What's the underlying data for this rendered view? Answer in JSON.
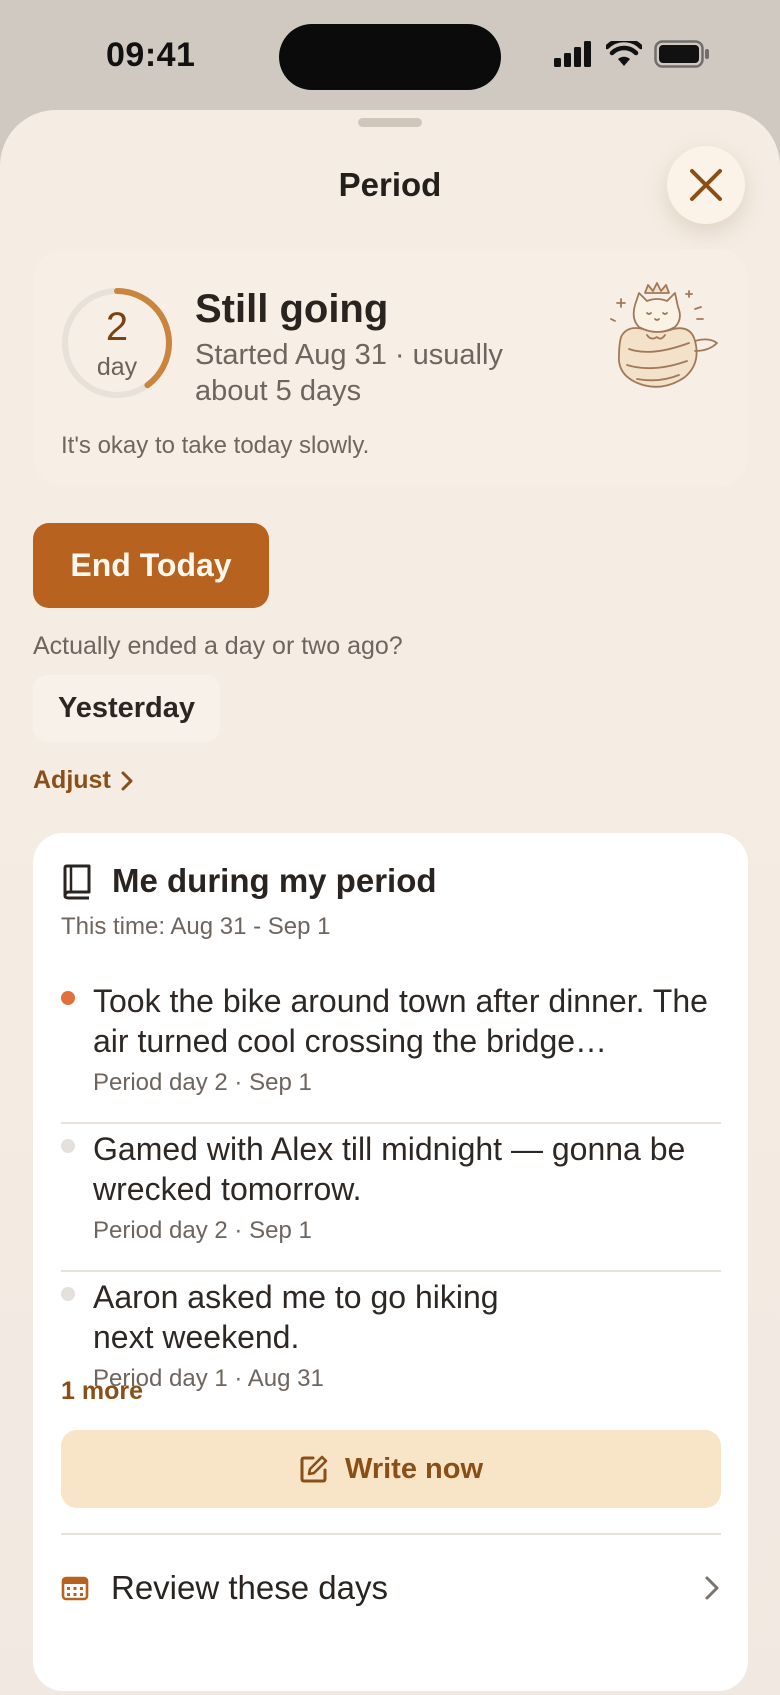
{
  "status_bar": {
    "time": "09:41"
  },
  "sheet": {
    "title": "Period"
  },
  "status_card": {
    "day_number": "2",
    "day_unit": "day",
    "progress_fraction": 0.4,
    "heading": "Still going",
    "subtitle": "Started Aug 31 · usually about 5 days",
    "note": "It's okay to take today slowly."
  },
  "actions": {
    "end_today_label": "End Today",
    "ended_question": "Actually ended a day or two ago?",
    "yesterday_label": "Yesterday",
    "adjust_label": "Adjust"
  },
  "journal": {
    "title": "Me during my period",
    "range": "This time: Aug 31 - Sep 1",
    "entries": [
      {
        "text": "Took the bike around town after dinner. The air turned cool crossing the bridge…",
        "meta": "Period day 2 · Sep 1"
      },
      {
        "text": "Gamed with Alex till midnight — gonna be wrecked tomorrow.",
        "meta": "Period day 2 · Sep 1"
      },
      {
        "text": "Aaron asked me to go hiking next weekend.",
        "meta": "Period day 1 · Aug 31"
      }
    ],
    "more_label": "1 more",
    "write_label": "Write now",
    "review_label": "Review these days"
  },
  "colors": {
    "accent": "#b8621f",
    "accent_text": "#8a4f16",
    "active_dot": "#e0703e",
    "inactive_dot": "#e4e0dc"
  }
}
